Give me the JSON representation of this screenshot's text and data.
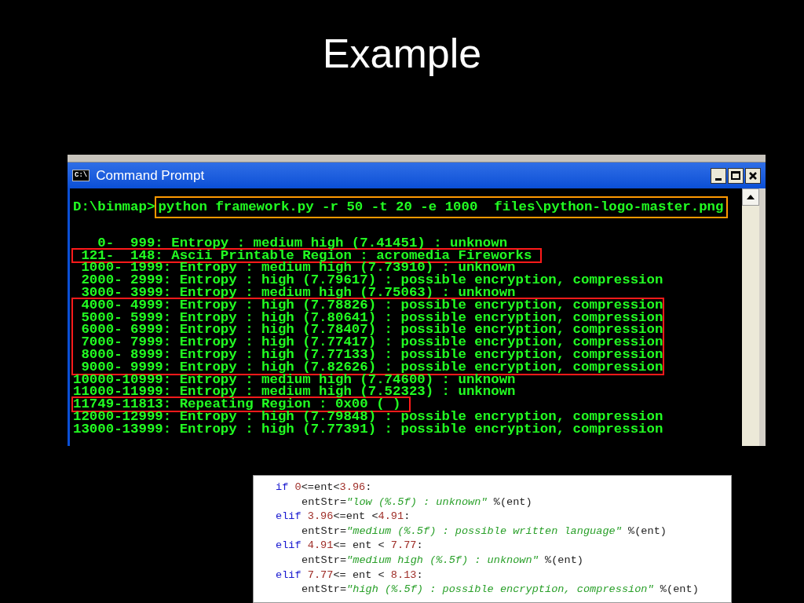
{
  "slide_title": "Example",
  "window": {
    "title": "Command Prompt",
    "icon_text": "C:\\",
    "command": {
      "prompt": "D:\\binmap>",
      "text": "python framework.py -r 50 -t 20 -e 1000  files\\python-logo-master.png"
    },
    "blocks": [
      {
        "kind": "plain",
        "lines": [
          "   0-  999: Entropy : medium high (7.41451) : unknown"
        ]
      },
      {
        "kind": "boxed",
        "lines": [
          " 121-  148: Ascii Printable Region : acromedia Fireworks "
        ]
      },
      {
        "kind": "plain",
        "lines": [
          " 1000- 1999: Entropy : medium high (7.73910) : unknown",
          " 2000- 2999: Entropy : high (7.79617) : possible encryption, compression",
          " 3000- 3999: Entropy : medium high (7.75063) : unknown"
        ]
      },
      {
        "kind": "boxed",
        "lines": [
          " 4000- 4999: Entropy : high (7.78826) : possible encryption, compression",
          " 5000- 5999: Entropy : high (7.80641) : possible encryption, compression",
          " 6000- 6999: Entropy : high (7.78407) : possible encryption, compression",
          " 7000- 7999: Entropy : high (7.77417) : possible encryption, compression",
          " 8000- 8999: Entropy : high (7.77133) : possible encryption, compression",
          " 9000- 9999: Entropy : high (7.82626) : possible encryption, compression"
        ]
      },
      {
        "kind": "plain",
        "lines": [
          "10000-10999: Entropy : medium high (7.74600) : unknown",
          "11000-11999: Entropy : medium high (7.52323) : unknown"
        ]
      },
      {
        "kind": "boxed",
        "lines": [
          "11749-11813: Repeating Region : 0x00 ( ) "
        ]
      },
      {
        "kind": "plain",
        "lines": [
          "12000-12999: Entropy : high (7.79848) : possible encryption, compression",
          "13000-13999: Entropy : high (7.77391) : possible encryption, compression"
        ]
      }
    ]
  },
  "code": [
    {
      "head": [
        {
          "kind": "keyword",
          "text": "if"
        },
        {
          "kind": "number",
          "text": "0"
        },
        {
          "kind": "plain",
          "text": "<=ent<"
        },
        {
          "kind": "number",
          "text": "3.96"
        },
        {
          "kind": "plain",
          "text": ":"
        }
      ],
      "children": [
        [
          {
            "kind": "plain",
            "text": "entStr="
          },
          {
            "kind": "string",
            "text": "\"low (%.5f) : unknown\""
          },
          {
            "kind": "plain",
            "text": " %(ent)"
          }
        ]
      ]
    },
    {
      "head": [
        {
          "kind": "keyword",
          "text": "elif"
        },
        {
          "kind": "number",
          "text": "3.96"
        },
        {
          "kind": "plain",
          "text": "<=ent <"
        },
        {
          "kind": "number",
          "text": "4.91"
        },
        {
          "kind": "plain",
          "text": ":"
        }
      ],
      "children": [
        [
          {
            "kind": "plain",
            "text": "entStr="
          },
          {
            "kind": "string",
            "text": "\"medium (%.5f) : possible written language\""
          },
          {
            "kind": "plain",
            "text": " %(ent)"
          }
        ]
      ]
    },
    {
      "head": [
        {
          "kind": "keyword",
          "text": "elif"
        },
        {
          "kind": "number",
          "text": "4.91"
        },
        {
          "kind": "plain",
          "text": "<= ent < "
        },
        {
          "kind": "number",
          "text": "7.77"
        },
        {
          "kind": "plain",
          "text": ":"
        }
      ],
      "children": [
        [
          {
            "kind": "plain",
            "text": "entStr="
          },
          {
            "kind": "string",
            "text": "\"medium high (%.5f) : unknown\""
          },
          {
            "kind": "plain",
            "text": " %(ent)"
          }
        ]
      ]
    },
    {
      "head": [
        {
          "kind": "keyword",
          "text": "elif"
        },
        {
          "kind": "number",
          "text": "7.77"
        },
        {
          "kind": "plain",
          "text": "<= ent < "
        },
        {
          "kind": "number",
          "text": "8.13"
        },
        {
          "kind": "plain",
          "text": ":"
        }
      ],
      "children": [
        [
          {
            "kind": "plain",
            "text": "entStr="
          },
          {
            "kind": "string",
            "text": "\"high (%.5f) : possible encryption, compression\""
          },
          {
            "kind": "plain",
            "text": " %(ent)"
          }
        ]
      ]
    }
  ]
}
